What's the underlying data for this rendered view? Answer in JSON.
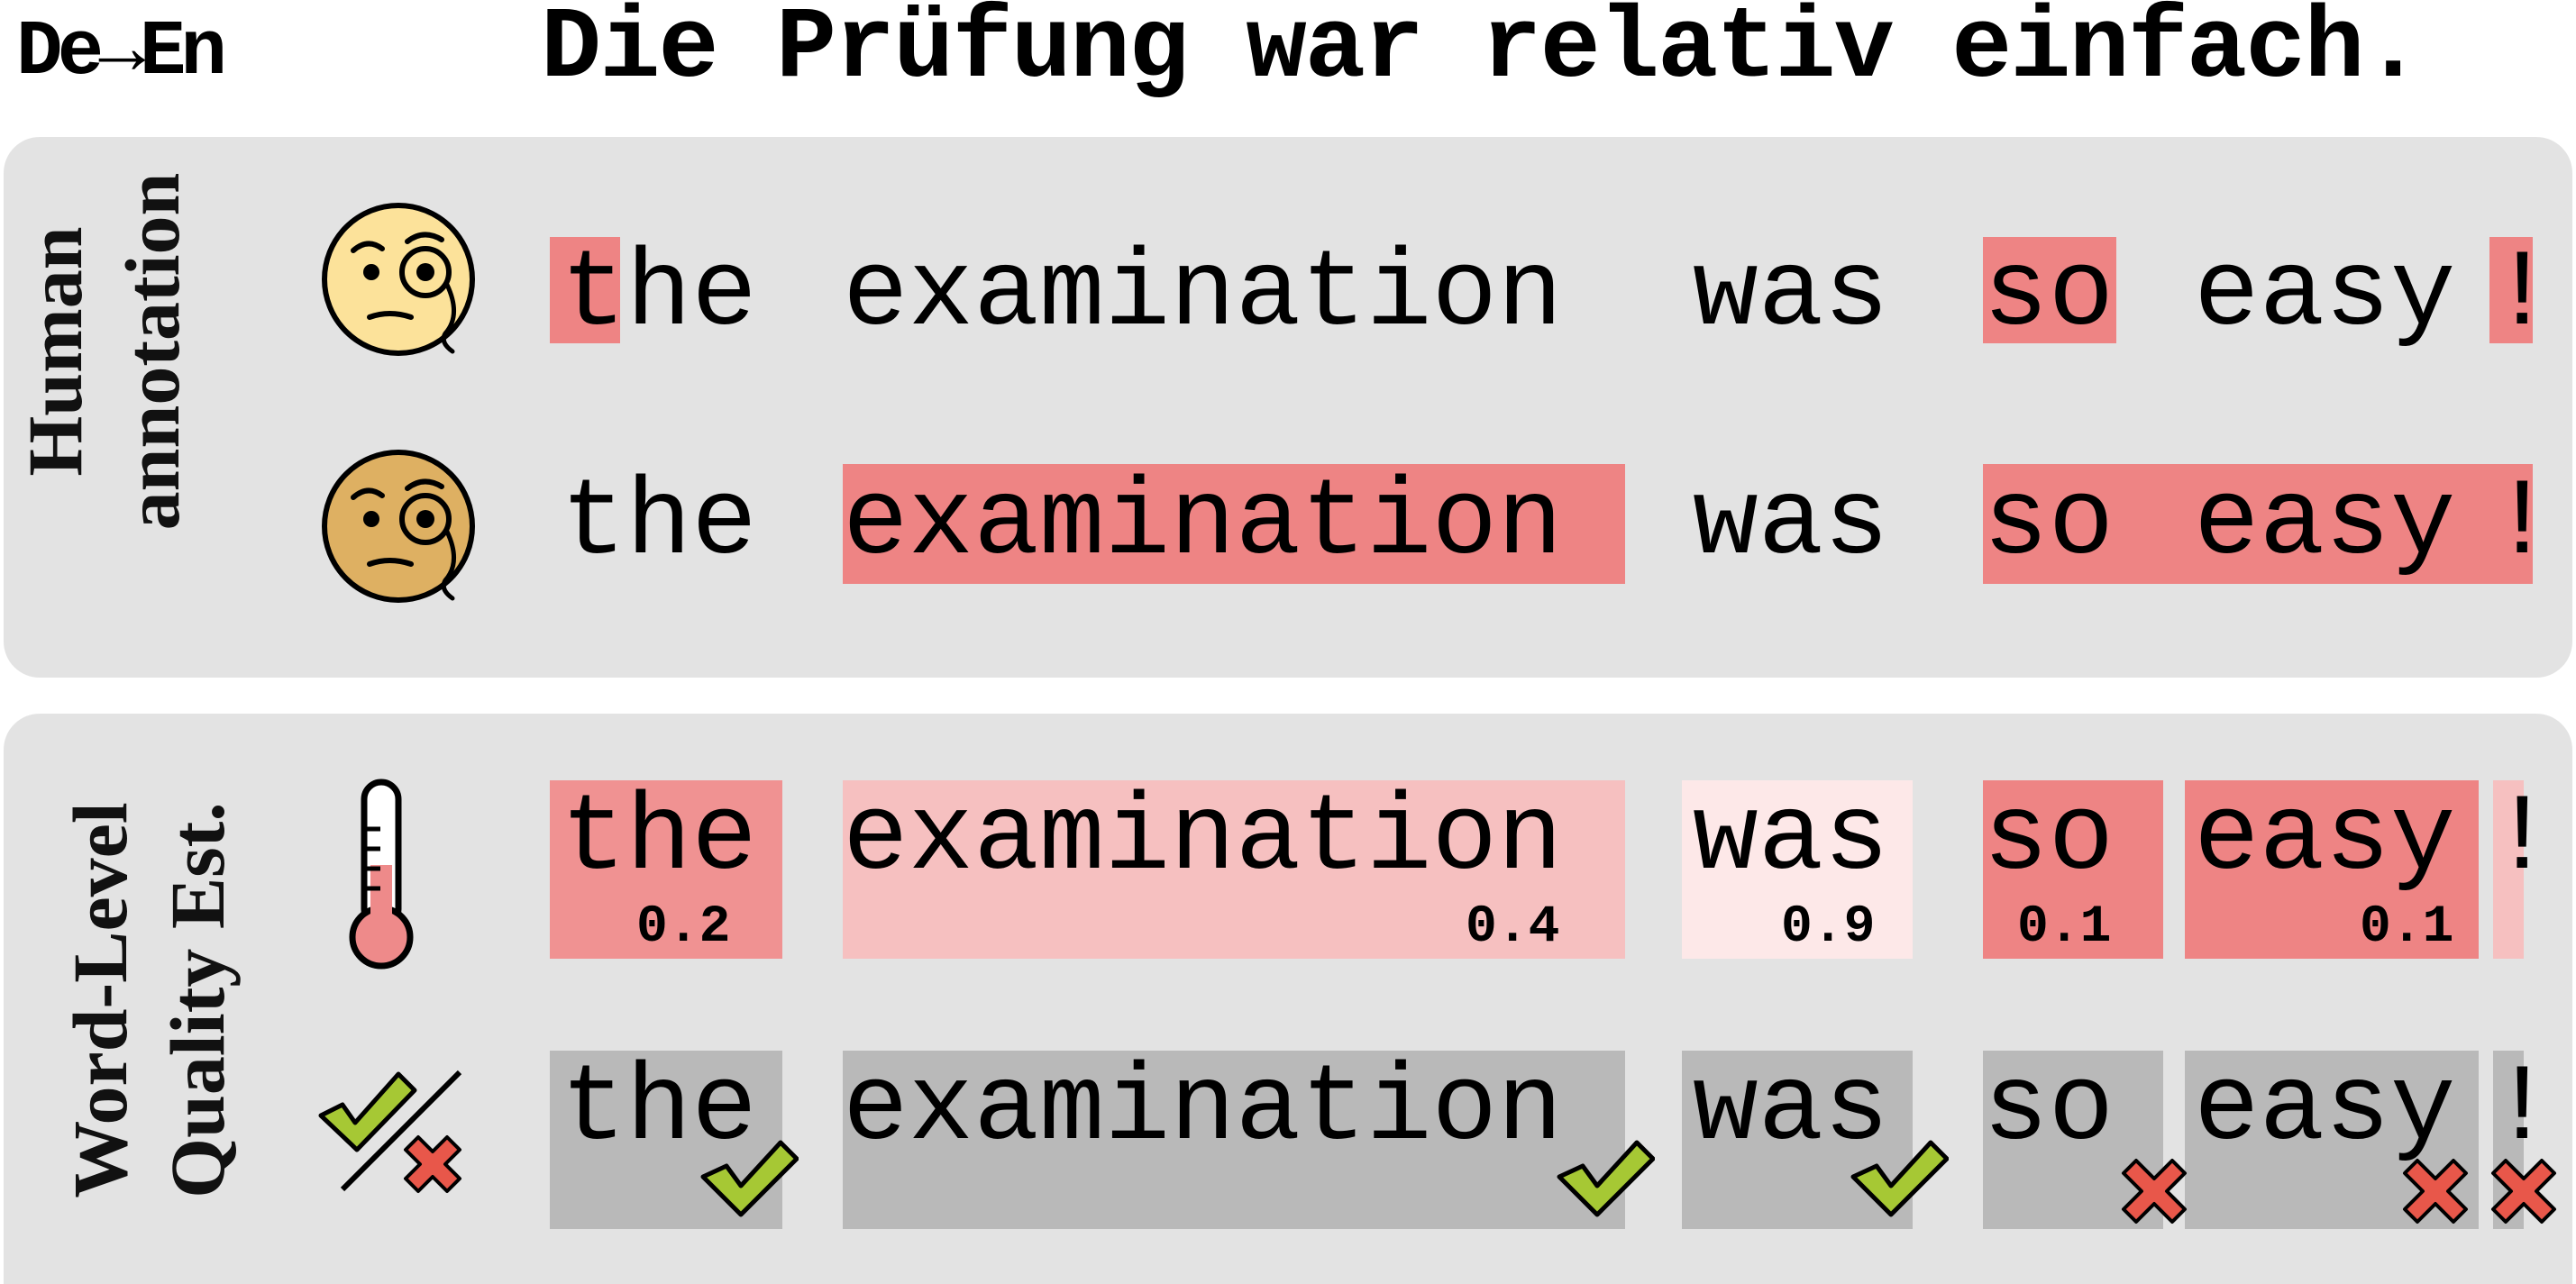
{
  "header": {
    "lang_pair": "De→En",
    "source_sentence": "Die Prüfung war relativ einfach."
  },
  "panels": {
    "human": {
      "label_line1": "Human",
      "label_line2": "annotation",
      "rows": [
        {
          "annotator": "annotator-1",
          "tokens": [
            "the",
            "examination",
            "was",
            "so",
            "easy",
            "!"
          ]
        },
        {
          "annotator": "annotator-2",
          "tokens": [
            "the",
            "examination",
            "was",
            "so",
            "easy",
            "!"
          ]
        }
      ]
    },
    "qe": {
      "label_line1": "Word-Level",
      "label_line2": "Quality Est.",
      "tokens": [
        "the",
        "examination",
        "was",
        "so",
        "easy",
        "!"
      ],
      "scores": [
        "0.2",
        "0.4",
        "0.9",
        "0.1",
        "0.1"
      ],
      "binary": [
        "ok",
        "ok",
        "ok",
        "bad",
        "bad",
        "bad"
      ]
    }
  },
  "colors": {
    "error": "#ee8484",
    "score_0.1": "#ee8484",
    "score_0.2": "#f09292",
    "score_0.4": "#f6c0c0",
    "score_0.9": "#fde8e8",
    "binary_bg": "#b9b9b9",
    "check": "#a6c834",
    "cross": "#e8574a",
    "face1": "#fce29a",
    "face2": "#deb062"
  },
  "icons": {
    "annotator_1": "monocle-face-icon",
    "annotator_2": "monocle-face-icon",
    "continuous": "thermometer-icon",
    "binary": "check-cross-icon"
  }
}
